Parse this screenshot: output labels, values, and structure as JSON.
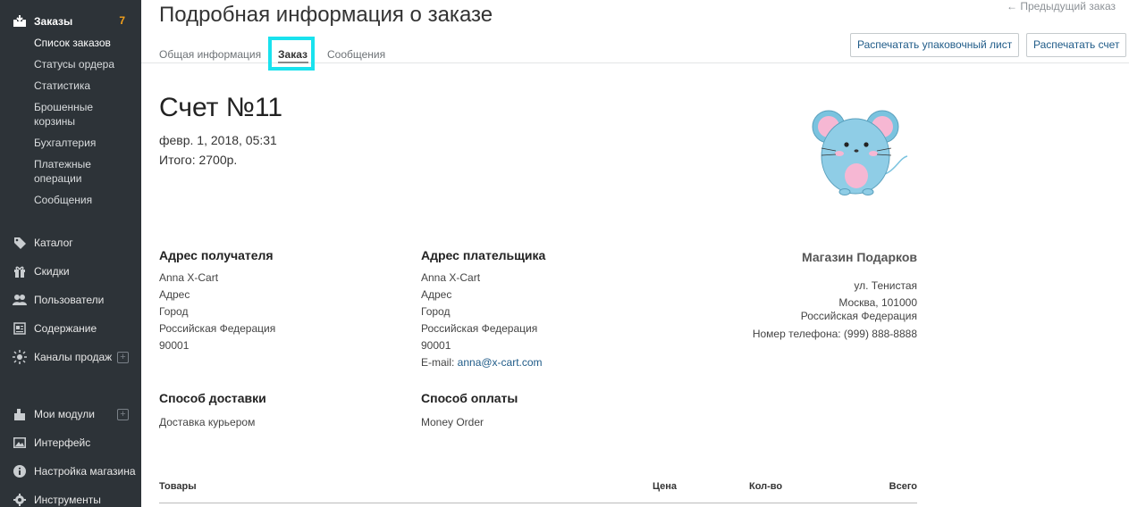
{
  "sidebar": {
    "orders": {
      "label": "Заказы",
      "count": "7",
      "icon": "orders-icon"
    },
    "orders_sub": [
      "Список заказов",
      "Статусы ордера",
      "Статистика",
      "Брошенные корзины",
      "Бухгалтерия",
      "Платежные операции",
      "Сообщения"
    ],
    "catalog": "Каталог",
    "discounts": "Скидки",
    "users": "Пользователи",
    "content": "Содержание",
    "sales_channels": "Каналы продаж",
    "my_modules": "Мои модули",
    "interface": "Интерфейс",
    "store_settings": "Настройка магазина",
    "tools": "Инструменты",
    "plus": "+"
  },
  "header": {
    "title": "Подробная информация о заказе",
    "prev_order": "← Предыдущий заказ",
    "tabs": [
      "Общая информация",
      "Заказ",
      "Сообщения"
    ],
    "active_tab": "Заказ",
    "print_packing": "Распечатать упаковочный лист",
    "print_invoice": "Распечатать счет"
  },
  "invoice": {
    "title": "Счет №11",
    "date": "февр. 1, 2018, 05:31",
    "total": "Итого: 2700р."
  },
  "shipping_address": {
    "title": "Адрес получателя",
    "lines": [
      "Anna X-Cart",
      "Адрес",
      "Город",
      "Российская Федерация",
      "90001"
    ]
  },
  "billing_address": {
    "title": "Адрес плательщика",
    "lines": [
      "Anna X-Cart",
      "Адрес",
      "Город",
      "Российская Федерация",
      "90001"
    ],
    "email_label": "E-mail: ",
    "email": "anna@x-cart.com"
  },
  "shop": {
    "name": "Магазин Подарков",
    "lines": [
      "ул. Тенистая",
      "Москва, 101000",
      "Российская Федерация",
      "Номер телефона: (999) 888-8888"
    ]
  },
  "delivery": {
    "title": "Способ доставки",
    "value": "Доставка курьером"
  },
  "payment": {
    "title": "Способ оплаты",
    "value": "Money Order"
  },
  "items_table": {
    "columns": [
      "Товары",
      "Цена",
      "Кол-во",
      "Всего"
    ]
  },
  "colors": {
    "sidebar_bg": "#2d3338",
    "accent": "#f4a11a",
    "link": "#1f5b88",
    "highlight": "#19e2ee"
  }
}
